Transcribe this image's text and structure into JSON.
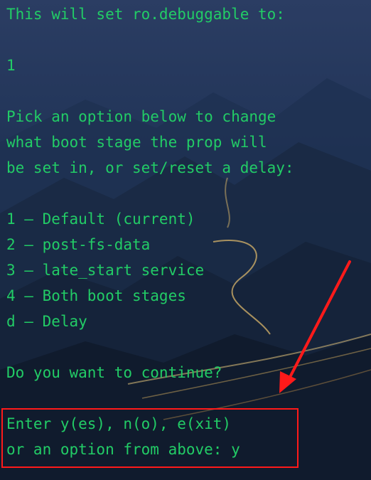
{
  "terminal": {
    "lines": {
      "l1": "This will set ro.debuggable to:",
      "l2": "1",
      "l3": "Pick an option below to change",
      "l4": "what boot stage the prop will",
      "l5": "be set in, or set/reset a delay:",
      "l6": "1 – Default (current)",
      "l7": "2 – post-fs-data",
      "l8": "3 – late_start service",
      "l9": "4 – Both boot stages",
      "l10": "d – Delay",
      "l11": "Do you want to continue?",
      "l12": "Enter y(es), n(o), e(xit)",
      "l13": "or an option from above: y"
    }
  },
  "colors": {
    "text": "#22cc66",
    "highlight": "#ff1a1a",
    "arrow": "#ff1a1a"
  }
}
